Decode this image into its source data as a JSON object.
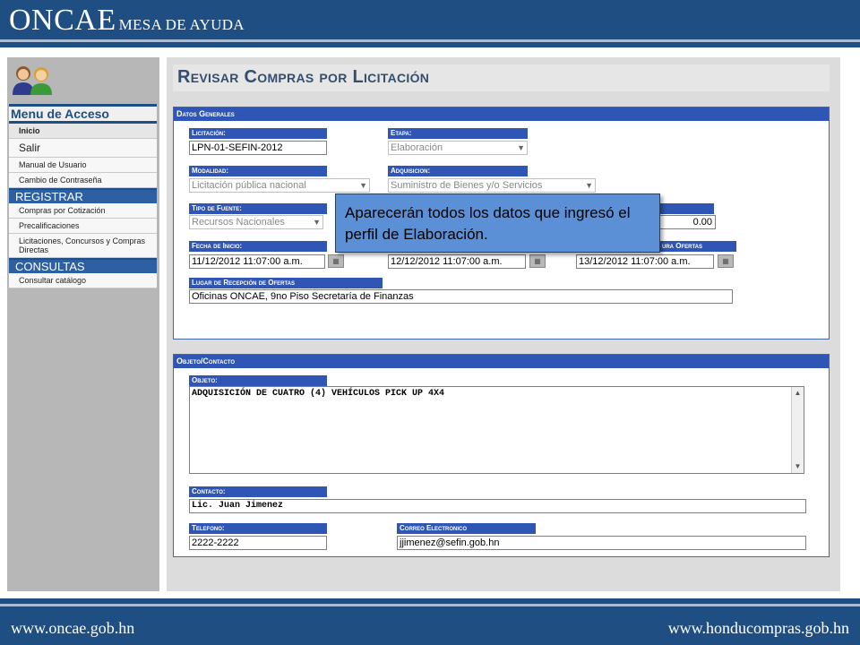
{
  "header": {
    "logo": "ONCAE",
    "subtitle": "MESA DE AYUDA"
  },
  "footer": {
    "left_url": "www.oncae.gob.hn",
    "right_url": "www.honducompras.gob.hn"
  },
  "sidebar": {
    "menu_title": "Menu de Acceso",
    "items": [
      {
        "label": "Inicio"
      },
      {
        "label": "Salir"
      },
      {
        "label": "Manual de Usuario"
      },
      {
        "label": "Cambio de Contraseña"
      }
    ],
    "sections": [
      {
        "label": "REGISTRAR",
        "items": [
          "Compras por Cotización",
          "Precalificaciones",
          "Licitaciones, Concursos y Compras Directas"
        ]
      },
      {
        "label": "CONSULTAS",
        "items": [
          "Consultar catálogo"
        ]
      }
    ]
  },
  "page": {
    "title": "Revisar Compras por Licitación"
  },
  "datos_generales": {
    "header": "Datos Generales",
    "licitacion": {
      "label": "Licitación:",
      "value": "LPN-01-SEFIN-2012"
    },
    "etapa": {
      "label": "Etapa:",
      "value": "Elaboración"
    },
    "modalidad": {
      "label": "Modalidad:",
      "value": "Licitación pública nacional"
    },
    "adquisicion": {
      "label": "Adquisicion:",
      "value": "Suministro de Bienes y/o Servicios"
    },
    "tipo_fuente": {
      "label": "Tipo de Fuente:",
      "value": "Recursos Nacionales"
    },
    "monto": {
      "value": "0.00"
    },
    "fecha_inicio": {
      "label": "Fecha de Inicio:",
      "value": "11/12/2012 11:07:00 a.m."
    },
    "fecha_2": {
      "value": "12/12/2012 11:07:00 a.m."
    },
    "fecha_apertura": {
      "label": "ura Ofertas",
      "value": "13/12/2012 11:07:00 a.m."
    },
    "lugar": {
      "label": "Lugar de Recepción de Ofertas",
      "value": "Oficinas ONCAE, 9no Piso Secretaría de Finanzas"
    }
  },
  "objeto_contacto": {
    "header": "Objeto/Contacto",
    "objeto": {
      "label": "Objeto:",
      "value": "ADQUISICIÓN DE CUATRO (4) VEHÍCULOS PICK UP 4X4"
    },
    "contacto": {
      "label": "Contacto:",
      "value": "Lic. Juan Jimenez"
    },
    "telefono": {
      "label": "Telefono:",
      "value": "2222-2222"
    },
    "correo": {
      "label": "Correo Electronico",
      "value": "jjimenez@sefin.gob.hn"
    }
  },
  "callout": {
    "text": "Aparecerán todos los datos que ingresó el perfil de Elaboración."
  },
  "icons": {
    "calendar": "calendar-icon",
    "dropdown": "chevron-down-icon",
    "users": "users-icon"
  },
  "colors": {
    "brand_blue": "#1f4f82",
    "label_blue": "#2f56b4",
    "callout": "#5b8fd6"
  }
}
